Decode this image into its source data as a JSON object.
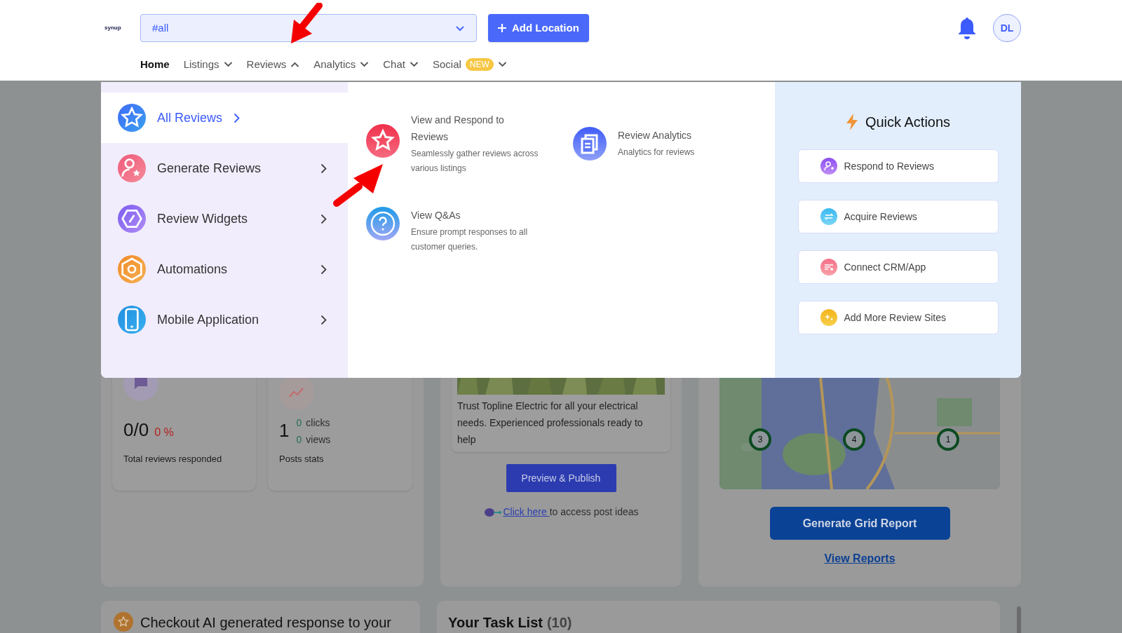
{
  "header": {
    "logo": "synup",
    "location_select": {
      "value": "#all"
    },
    "add_location_button": "Add Location",
    "avatar": "DL"
  },
  "nav": [
    {
      "label": "Home",
      "kind": "link",
      "selected": true
    },
    {
      "label": "Listings",
      "kind": "menu",
      "selected": false,
      "expanded": false
    },
    {
      "label": "Reviews",
      "kind": "menu",
      "selected": false,
      "expanded": true
    },
    {
      "label": "Analytics",
      "kind": "menu",
      "selected": false,
      "expanded": false
    },
    {
      "label": "Chat",
      "kind": "menu",
      "selected": false,
      "expanded": false
    },
    {
      "label": "Social",
      "kind": "menu",
      "selected": false,
      "expanded": false,
      "badge": "NEW"
    }
  ],
  "reviews_menu": {
    "categories": [
      {
        "label": "All Reviews",
        "selected": true
      },
      {
        "label": "Generate Reviews",
        "selected": false
      },
      {
        "label": "Review Widgets",
        "selected": false
      },
      {
        "label": "Automations",
        "selected": false
      },
      {
        "label": "Mobile Application",
        "selected": false
      }
    ],
    "items": [
      {
        "title": "View and Respond to Reviews",
        "description": "Seamlessly gather reviews across various listings"
      },
      {
        "title": "Review Analytics",
        "description": "Analytics for reviews"
      },
      {
        "title": "View Q&As",
        "description": "Ensure prompt responses to all customer queries."
      }
    ],
    "quick_actions": {
      "title": "Quick Actions",
      "actions": [
        "Respond to Reviews",
        "Acquire Reviews",
        "Connect CRM/App",
        "Add More Review Sites"
      ]
    }
  },
  "dashboard": {
    "reviews_stat": {
      "value": "0/0",
      "percent": "0 %",
      "label": "Total reviews responded"
    },
    "posts_stat": {
      "value": "1",
      "clicks": "0",
      "clicks_label": "clicks",
      "views": "0",
      "views_label": "views",
      "label": "Posts stats"
    },
    "post": {
      "text": "Trust Topline Electric for all your electrical needs. Experienced professionals ready to help",
      "publish_button": "Preview & Publish",
      "ideas_link": "Click here ",
      "ideas_text": "to access post ideas"
    },
    "grid": {
      "markers": [
        "3",
        "4",
        "1"
      ],
      "generate_button": "Generate Grid Report",
      "reports_link": "View Reports"
    },
    "ai_card": {
      "title": "Checkout AI generated response to your"
    },
    "task_list": {
      "title": "Your Task List",
      "count": "(10)"
    }
  }
}
